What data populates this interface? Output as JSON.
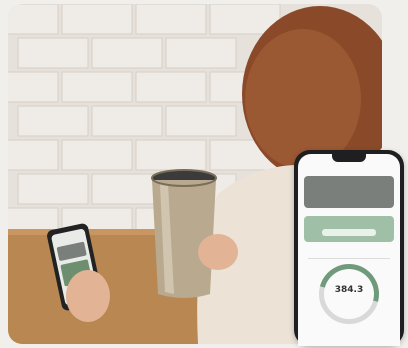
{
  "phone_app": {
    "status_time": "",
    "title": "",
    "summary_header": "",
    "summary_numbers": "",
    "summary_sub": "",
    "green_card_text": "",
    "section_label": "",
    "ring_label": "",
    "ring_value": "384.3",
    "ring_value_secondary": ""
  },
  "colors": {
    "card_dark": "#7b7f7c",
    "card_green": "#9fbfa6",
    "ring_progress": "#6f9b7c",
    "tumbler": "#b9a98f"
  },
  "icons": [
    "phone-icon",
    "tumbler-icon"
  ]
}
